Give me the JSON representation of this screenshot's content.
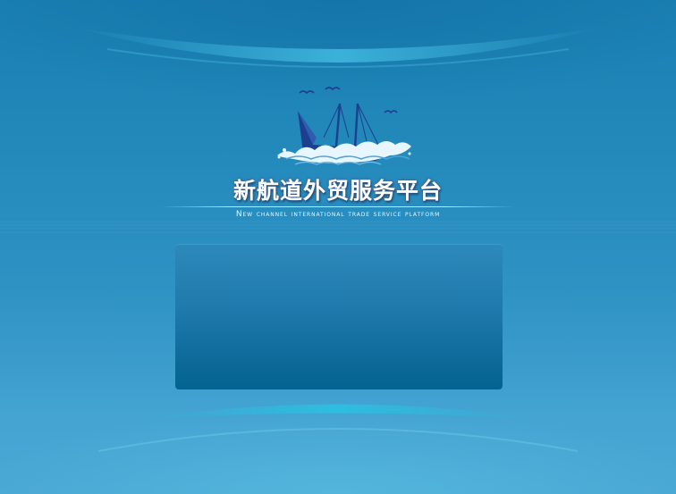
{
  "header": {
    "title_cn": "新航道外贸服务平台",
    "title_en": "New channel international trade service platform"
  },
  "logo": {
    "icon": "sailing-ship-icon"
  },
  "colors": {
    "background_top": "#1a7fb2",
    "background_bottom": "#4aa8d4",
    "panel_top": "#2e89bb",
    "panel_bottom": "#036391",
    "ship": "#1c3f8f"
  }
}
